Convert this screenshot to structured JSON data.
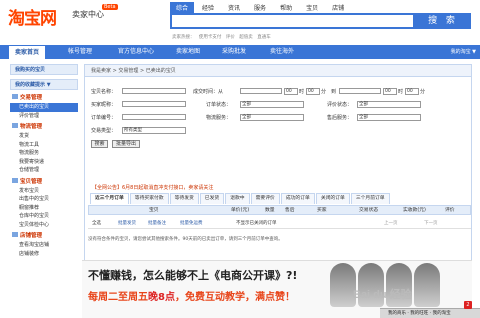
{
  "header": {
    "logo": "淘宝网",
    "logo_sub": "卖家中心",
    "beta": "Beta",
    "search_tabs": [
      "综合",
      "经验",
      "资讯",
      "服务",
      "帮助",
      "宝贝",
      "店铺"
    ],
    "search_button": "搜 索",
    "hotline": "卖家热搜：  使用卡支付  评价  超值卖  直通车"
  },
  "nav": {
    "items": [
      "卖家首页",
      "帐号管理",
      "官方信息中心",
      "卖家地图",
      "采购批发",
      "卖往海外"
    ],
    "my": "我的淘宝 ▼"
  },
  "sidebar": {
    "top": [
      "我购买的宝贝",
      "我的收藏提示 ▼"
    ],
    "groups": [
      {
        "title": "交易管理",
        "items": [
          "已卖出的宝贝",
          "评价管理"
        ]
      },
      {
        "title": "物流管理",
        "items": [
          "发货",
          "物流工具",
          "物流服务",
          "我要寄快递",
          "仓储管理"
        ]
      },
      {
        "title": "宝贝管理",
        "items": [
          "发布宝贝",
          "出售中的宝贝",
          "橱窗推荐",
          "仓库中的宝贝",
          "宝贝体检中心"
        ]
      },
      {
        "title": "店铺管理",
        "items": [
          "查看淘宝店铺",
          "店铺装修"
        ]
      }
    ],
    "selected": "已卖出的宝贝"
  },
  "breadcrumb": "我是卖家 > 交易管理 > 已卖出的宝贝",
  "form": {
    "product_name": "宝贝名称：",
    "buyer_nick": "买家昵称：",
    "order_no": "订单编号：",
    "trade_type": "交易类型：",
    "trade_type_value": "所有类型",
    "deal_time": "成交时间：从",
    "to": "到",
    "time_sep": "时",
    "minute": "分",
    "order_status": "订单状态：",
    "logistics": "物流服务：",
    "eval_status": "评价状态：",
    "after_sale": "售后服务：",
    "all": "全部",
    "hour_value": "00",
    "search_btn": "搜索",
    "export_btn": "批量导出"
  },
  "notice": "【全网公告】6月8日起取消直冲支付接口，卖家请关注",
  "order_tabs": [
    "近三个月订单",
    "等待买家付款",
    "等待发货",
    "已发货",
    "退款中",
    "需要评价",
    "成功的订单",
    "关闭的订单",
    "三个月前订单"
  ],
  "table": {
    "headers": [
      "宝贝",
      "单价(元)",
      "数量",
      "售后",
      "买家",
      "交易状态",
      "实收款(元)",
      "评价"
    ],
    "row": {
      "select_all": "全选",
      "batch_ship": "批量发货",
      "batch_memo": "批量备注",
      "free_ship": "批量免运费",
      "no_show": "不显示已关闭的订单",
      "prev": "上一页",
      "next": "下一页"
    },
    "empty": "没有符合条件的宝贝，请您尝试其他搜索条件。90天前的已卖出订单，请到三个月前订单中查询。"
  },
  "banner": {
    "line1": "不懂赚钱，怎么能够不上《电商公开课》?!",
    "line2_pre": "每周二至周五",
    "line2_time": "晚8点",
    "line2_mid": "，免费",
    "line2_post": "互动教学，满点赞！"
  },
  "watermark": "Bai du 经验",
  "tray": {
    "text": "我的商乐 · 我的旺旺 · 我的淘宝",
    "badge": "2"
  }
}
